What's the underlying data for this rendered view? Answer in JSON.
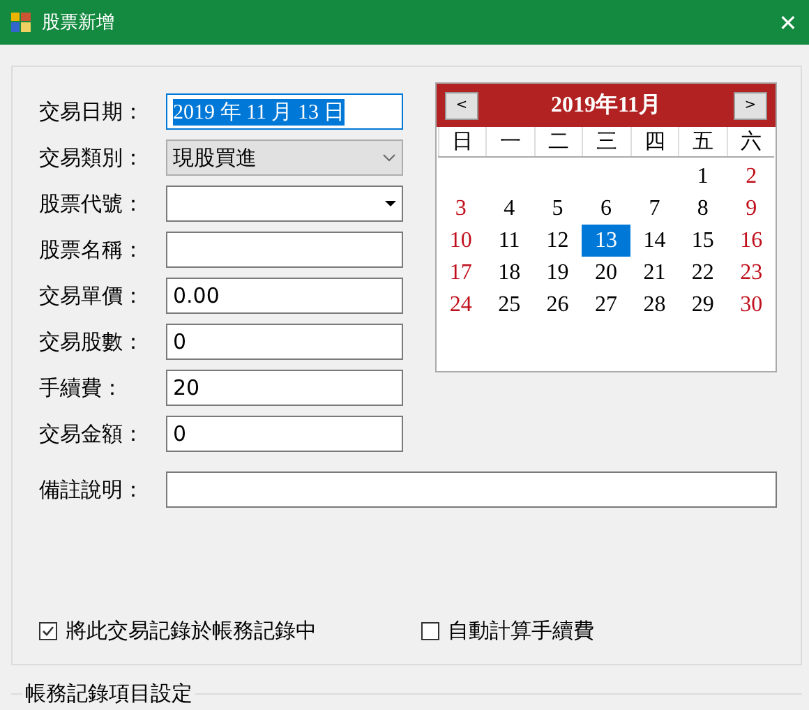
{
  "window": {
    "title": "股票新增",
    "close": "✕"
  },
  "fields": [
    {
      "label": "交易日期：",
      "kind": "date",
      "value": "2019 年 11 月 13 日"
    },
    {
      "label": "交易類別：",
      "kind": "combo",
      "value": "現股買進"
    },
    {
      "label": "股票代號：",
      "kind": "dropdown"
    },
    {
      "label": "股票名稱：",
      "kind": "text"
    },
    {
      "label": "交易單價：",
      "kind": "text",
      "value": "0.00"
    },
    {
      "label": "交易股數：",
      "kind": "text",
      "value": "0"
    },
    {
      "label": "手續費：",
      "kind": "text",
      "value": "20"
    },
    {
      "label": "交易金額：",
      "kind": "text",
      "value": "0"
    }
  ],
  "remarks": {
    "label": "備註說明："
  },
  "calendar": {
    "title": "2019年11月",
    "prev": "<",
    "next": ">",
    "weekdays": [
      "日",
      "一",
      "二",
      "三",
      "四",
      "五",
      "六"
    ],
    "weeks": [
      [
        {
          "kind": "blank"
        },
        {
          "kind": "blank"
        },
        {
          "kind": "blank"
        },
        {
          "kind": "blank"
        },
        {
          "kind": "blank"
        },
        {
          "kind": "day",
          "day": "1",
          "weekend": false,
          "selected": false
        },
        {
          "kind": "day",
          "day": "2",
          "weekend": true,
          "selected": false
        }
      ],
      [
        {
          "kind": "day",
          "day": "3",
          "weekend": true,
          "selected": false
        },
        {
          "kind": "day",
          "day": "4",
          "weekend": false,
          "selected": false
        },
        {
          "kind": "day",
          "day": "5",
          "weekend": false,
          "selected": false
        },
        {
          "kind": "day",
          "day": "6",
          "weekend": false,
          "selected": false
        },
        {
          "kind": "day",
          "day": "7",
          "weekend": false,
          "selected": false
        },
        {
          "kind": "day",
          "day": "8",
          "weekend": false,
          "selected": false
        },
        {
          "kind": "day",
          "day": "9",
          "weekend": true,
          "selected": false
        }
      ],
      [
        {
          "kind": "day",
          "day": "10",
          "weekend": true,
          "selected": false
        },
        {
          "kind": "day",
          "day": "11",
          "weekend": false,
          "selected": false
        },
        {
          "kind": "day",
          "day": "12",
          "weekend": false,
          "selected": false
        },
        {
          "kind": "day",
          "day": "13",
          "weekend": false,
          "selected": true
        },
        {
          "kind": "day",
          "day": "14",
          "weekend": false,
          "selected": false
        },
        {
          "kind": "day",
          "day": "15",
          "weekend": false,
          "selected": false
        },
        {
          "kind": "day",
          "day": "16",
          "weekend": true,
          "selected": false
        }
      ],
      [
        {
          "kind": "day",
          "day": "17",
          "weekend": true,
          "selected": false
        },
        {
          "kind": "day",
          "day": "18",
          "weekend": false,
          "selected": false
        },
        {
          "kind": "day",
          "day": "19",
          "weekend": false,
          "selected": false
        },
        {
          "kind": "day",
          "day": "20",
          "weekend": false,
          "selected": false
        },
        {
          "kind": "day",
          "day": "21",
          "weekend": false,
          "selected": false
        },
        {
          "kind": "day",
          "day": "22",
          "weekend": false,
          "selected": false
        },
        {
          "kind": "day",
          "day": "23",
          "weekend": true,
          "selected": false
        }
      ],
      [
        {
          "kind": "day",
          "day": "24",
          "weekend": true,
          "selected": false
        },
        {
          "kind": "day",
          "day": "25",
          "weekend": false,
          "selected": false
        },
        {
          "kind": "day",
          "day": "26",
          "weekend": false,
          "selected": false
        },
        {
          "kind": "day",
          "day": "27",
          "weekend": false,
          "selected": false
        },
        {
          "kind": "day",
          "day": "28",
          "weekend": false,
          "selected": false
        },
        {
          "kind": "day",
          "day": "29",
          "weekend": false,
          "selected": false
        },
        {
          "kind": "day",
          "day": "30",
          "weekend": true,
          "selected": false
        }
      ]
    ]
  },
  "options": [
    {
      "label": "將此交易記錄於帳務記錄中",
      "checked": true
    },
    {
      "label": "自動計算手續費",
      "checked": false
    }
  ],
  "next_group": {
    "title": "帳務記錄項目設定"
  }
}
